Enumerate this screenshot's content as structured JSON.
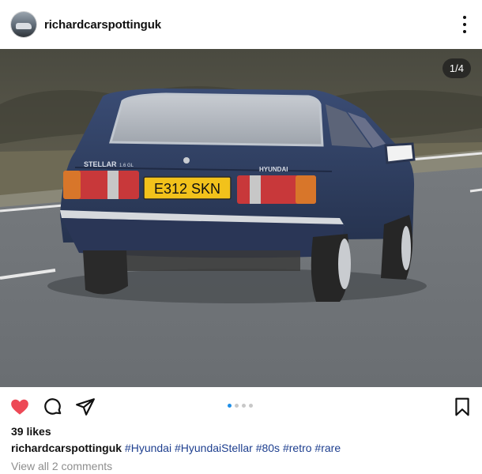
{
  "post": {
    "username": "richardcarspottinguk",
    "media_counter": "1/4",
    "plate": "E312 SKN",
    "badge_left": "STELLAR",
    "badge_left_sub": "1.6 GL",
    "badge_right": "HYUNDAI",
    "likes": "39 likes",
    "caption_user": "richardcarspottinguk",
    "hashtags": [
      "#Hyundai",
      "#HyundaiStellar",
      "#80s",
      "#retro",
      "#rare"
    ],
    "view_comments": "View all 2 comments",
    "carousel": {
      "count": 4,
      "active_index": 0
    }
  },
  "colors": {
    "like_red": "#ed4956",
    "hashtag_blue": "#1e3f8f",
    "dot_active": "#1f8fe8",
    "car_body": "#2e3f63",
    "plate_yellow": "#f2c21b"
  },
  "icons": {
    "like": "heart-icon",
    "comment": "comment-icon",
    "share": "paper-plane-icon",
    "save": "bookmark-icon",
    "more": "more-vertical-icon"
  }
}
